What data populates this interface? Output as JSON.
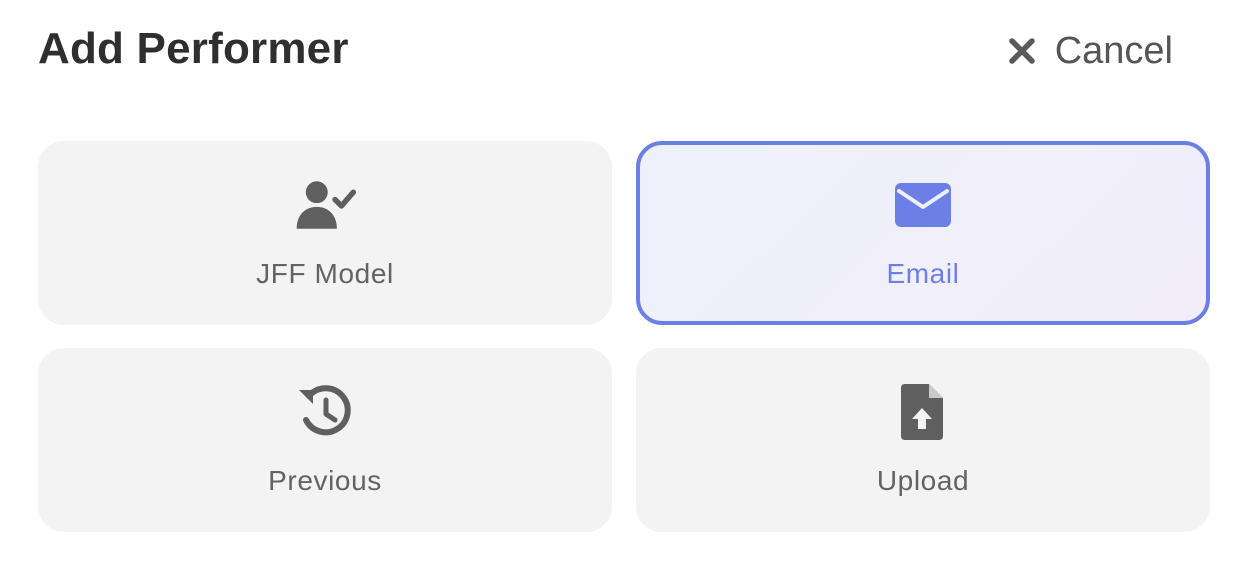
{
  "dialog": {
    "title": "Add Performer",
    "cancel_label": "Cancel",
    "cancel_icon": "close-icon"
  },
  "options": [
    {
      "label": "JFF Model",
      "icon": "user-check-icon",
      "selected": false
    },
    {
      "label": "Email",
      "icon": "envelope-icon",
      "selected": true
    },
    {
      "label": "Previous",
      "icon": "history-icon",
      "selected": false
    },
    {
      "label": "Upload",
      "icon": "file-upload-icon",
      "selected": false
    }
  ],
  "colors": {
    "accent": "#6c7fe6",
    "card_background": "#f3f3f3",
    "selected_background": "#efeffa",
    "text_primary": "#2f2f2f",
    "text_secondary": "#636363",
    "icon_gray": "#5f5f5f"
  }
}
